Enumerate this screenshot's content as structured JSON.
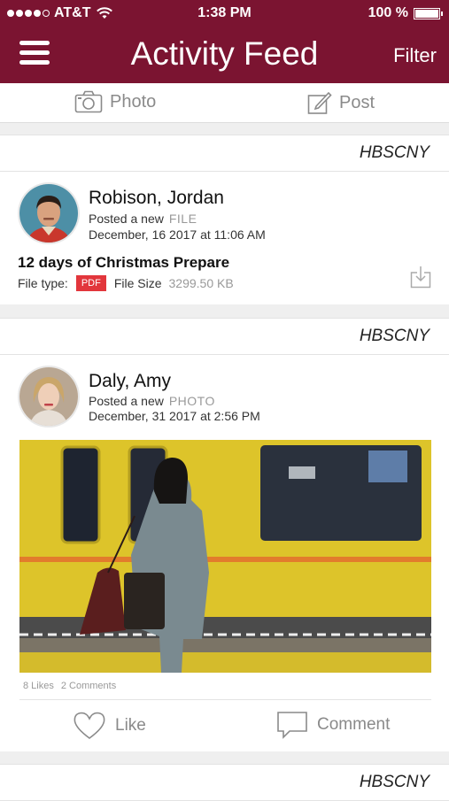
{
  "status": {
    "carrier": "AT&T",
    "time": "1:38 PM",
    "battery": "100 %"
  },
  "nav": {
    "title": "Activity Feed",
    "filter": "Filter"
  },
  "composer": {
    "photo_label": "Photo",
    "post_label": "Post"
  },
  "groups": [
    "HBSCNY",
    "HBSCNY",
    "HBSCNY"
  ],
  "posts": [
    {
      "author": "Robison, Jordan",
      "posted_prefix": "Posted a new",
      "type": "FILE",
      "date": "December, 16 2017 at 11:06 AM",
      "file_title": "12 days of Christmas Prepare",
      "file_type_label": "File type:",
      "file_type": "PDF",
      "file_size_label": "File Size",
      "file_size": "3299.50 KB"
    },
    {
      "author": "Daly, Amy",
      "posted_prefix": "Posted a new",
      "type": "PHOTO",
      "date": "December, 31 2017 at 2:56 PM",
      "likes": "8 Likes",
      "comments": "2 Comments",
      "like_label": "Like",
      "comment_label": "Comment"
    }
  ],
  "colors": {
    "brand": "#7b1431",
    "muted": "#8a8a8a",
    "pdf": "#e2363c"
  }
}
